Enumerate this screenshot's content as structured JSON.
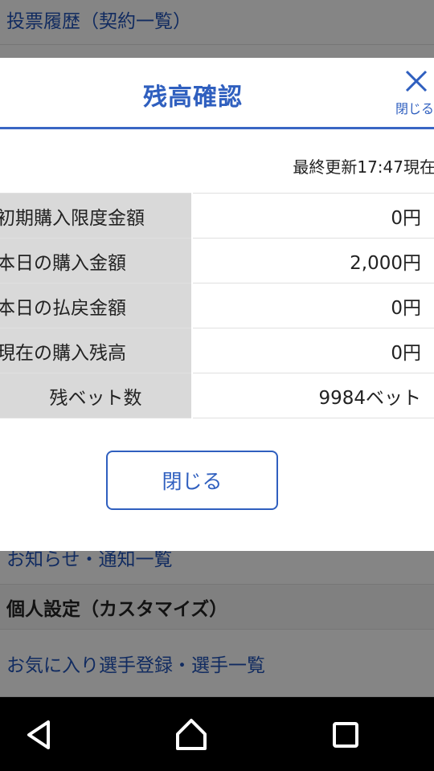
{
  "background": {
    "top_row": "投票履歴（契約一覧）",
    "notice_row": "お知らせ・通知一覧",
    "section_header": "個人設定（カスタマイズ）",
    "favorites_row": "お気に入り選手登録・選手一覧"
  },
  "modal": {
    "title": "残高確認",
    "close_label": "閉じる",
    "updated": "最終更新17:47現在",
    "rows": [
      {
        "label": "初期購入限度金額",
        "value": "0円"
      },
      {
        "label": "本日の購入金額",
        "value": "2,000円"
      },
      {
        "label": "本日の払戻金額",
        "value": "0円"
      },
      {
        "label": "現在の購入残高",
        "value": "0円"
      },
      {
        "label": "残ベット数",
        "value": "9984ベット"
      }
    ],
    "close_button": "閉じる"
  },
  "navbar": {
    "icons": [
      "back-icon",
      "home-icon",
      "recents-icon"
    ]
  },
  "colors": {
    "accent": "#2f5fbf",
    "label_bg": "#d9d9d9",
    "overlay": "rgba(0,0,0,0.45)"
  }
}
